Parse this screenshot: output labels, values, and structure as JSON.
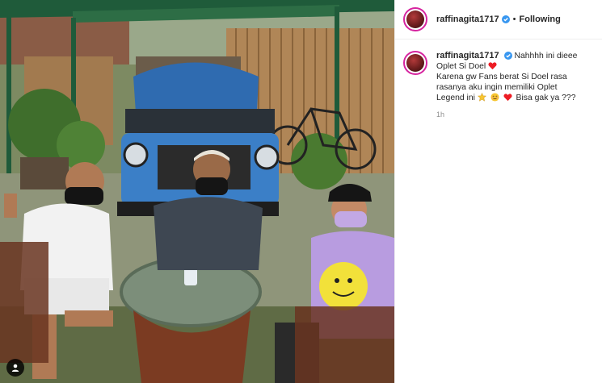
{
  "post": {
    "username": "raffinagita1717",
    "follow_label": "Following",
    "dot": "•"
  },
  "caption": {
    "author": "raffinagita1717",
    "line1": "Nahhhh ini dieee",
    "line2": "Oplet Si Doel",
    "line3": "Karena gw Fans berat Si Doel rasa",
    "line4": "rasanya aku ingin memiliki Oplet",
    "line5": "Legend ini",
    "line5_end": "Bisa gak ya ???",
    "emojis": [
      "star-emoji",
      "smiling-face-emoji",
      "red-heart-emoji"
    ],
    "heart_after_line2": "red-heart-emoji"
  },
  "timestamp": "1h",
  "icons": {
    "verified": "verified-badge-icon",
    "user_tag": "user-tag-icon"
  },
  "colors": {
    "verified": "#3897f0",
    "heart": "#ed1c24",
    "story_ring": "#d6249f",
    "text": "#262626",
    "muted": "#8e8e8e"
  }
}
